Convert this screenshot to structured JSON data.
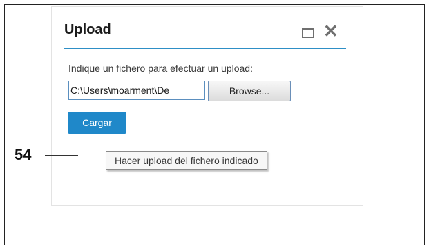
{
  "dialog": {
    "title": "Upload",
    "instruction": "Indique un fichero para efectuar un upload:",
    "file_input_value": "C:\\Users\\moarment\\De",
    "browse_label": "Browse...",
    "submit_label": "Cargar",
    "tooltip": "Hacer upload del fichero indicado",
    "window_icons": [
      "maximize-icon",
      "close-icon"
    ],
    "accent_color": "#1f88c9"
  },
  "annotation": {
    "reference_number": "54"
  }
}
